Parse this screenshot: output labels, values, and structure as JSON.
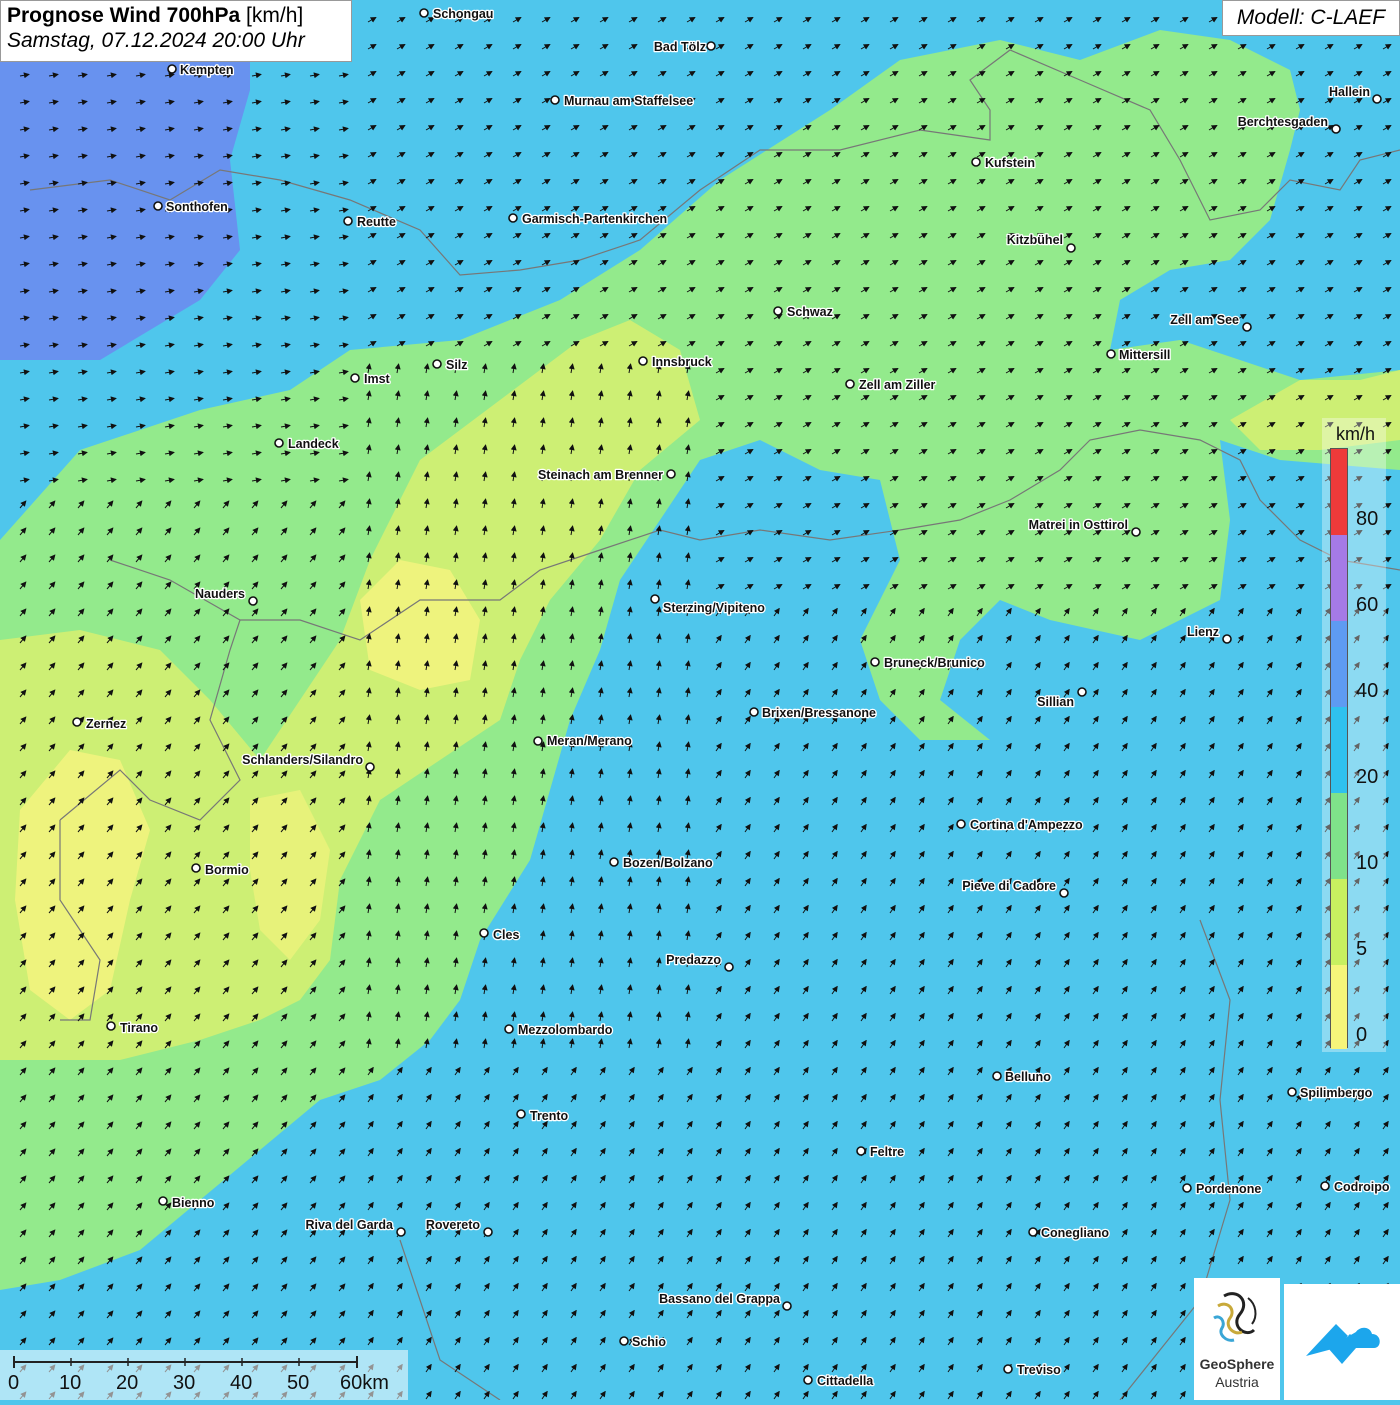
{
  "header": {
    "title_bold": "Prognose Wind 700hPa",
    "title_unit": " [km/h]",
    "datetime": "Samstag, 07.12.2024 20:00 Uhr",
    "model": "Modell: C-LAEF"
  },
  "legend": {
    "unit": "km/h",
    "labels": [
      "80",
      "60",
      "40",
      "20",
      "10",
      "5",
      "0"
    ],
    "colors": [
      "#ee3a3a",
      "#a57ae6",
      "#5e9bf2",
      "#2fc1ee",
      "#7fe28a",
      "#c8f060",
      "#f6f57a"
    ]
  },
  "scalebar": {
    "labels": [
      "0",
      "10",
      "20",
      "30",
      "40",
      "50",
      "60km"
    ]
  },
  "logos": {
    "geosphere_line1": "GeoSphere",
    "geosphere_line2": "Austria",
    "geosphere_icon": "geosphere-logo-icon",
    "second_icon": "mountain-cloud-logo-icon",
    "brand_blue": "#1ca6ec"
  },
  "cities": [
    "Schongau",
    "Bad Tölz",
    "Kempten",
    "Murnau am Staffelsee",
    "Hallein",
    "Berchtesgaden",
    "Kufstein",
    "Sonthofen",
    "Reutte",
    "Garmisch-Partenkirchen",
    "Kitzbühel",
    "Schwaz",
    "Zell am See",
    "Innsbruck",
    "Mittersill",
    "Imst",
    "Silz",
    "Zell am Ziller",
    "Landeck",
    "Steinach am Brenner",
    "Matrei in Osttirol",
    "Nauders",
    "Sterzing/Vipiteno",
    "Lienz",
    "Bruneck/Brunico",
    "Sillian",
    "Zernez",
    "Brixen/Bressanone",
    "Meran/Merano",
    "Schlanders/Silandro",
    "Cortina d'Ampezzo",
    "Bozen/Bolzano",
    "Bormio",
    "Pieve di Cadore",
    "Cles",
    "Predazzo",
    "Tirano",
    "Mezzolombardo",
    "Belluno",
    "Spilimbergo",
    "Trento",
    "Feltre",
    "Pordenone",
    "Codroipo",
    "Bienno",
    "Riva del Garda",
    "Rovereto",
    "Conegliano",
    "Bassano del Grappa",
    "Schio",
    "Treviso",
    "Cittadella"
  ],
  "field_colors": {
    "strong_blue": "#6a8cf0",
    "blue": "#4fc6ec",
    "green": "#93ea8c",
    "yellowgreen": "#cdef74",
    "yellow": "#f2f37e"
  }
}
